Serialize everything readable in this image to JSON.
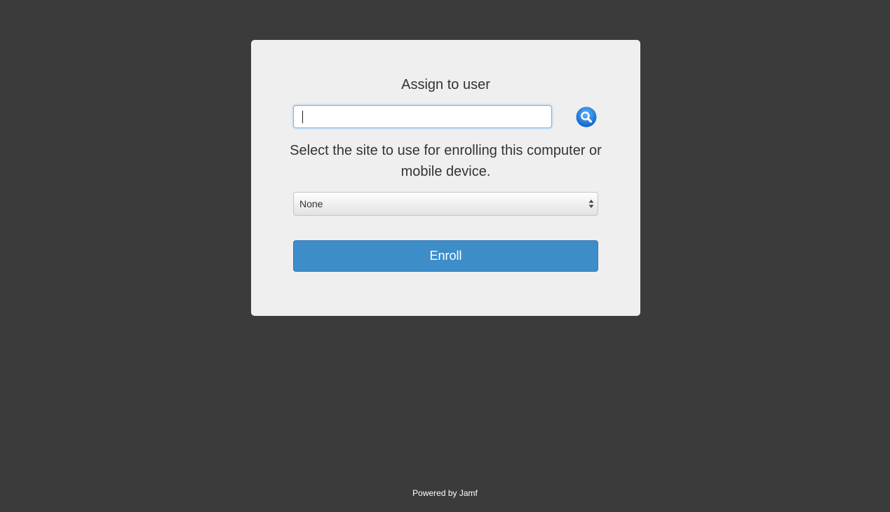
{
  "card": {
    "title": "Assign to user",
    "user_field": {
      "value": "",
      "placeholder": ""
    },
    "search_icon": "magnifier-icon",
    "description": "Select the site to use for enrolling this computer or mobile device.",
    "site_select": {
      "selected": "None"
    },
    "enroll_label": "Enroll"
  },
  "footer": {
    "text": "Powered by Jamf"
  },
  "colors": {
    "background": "#3b3b3b",
    "card": "#efefef",
    "primary_button": "#3d8dc9",
    "search_icon": "#1e7ee0"
  }
}
